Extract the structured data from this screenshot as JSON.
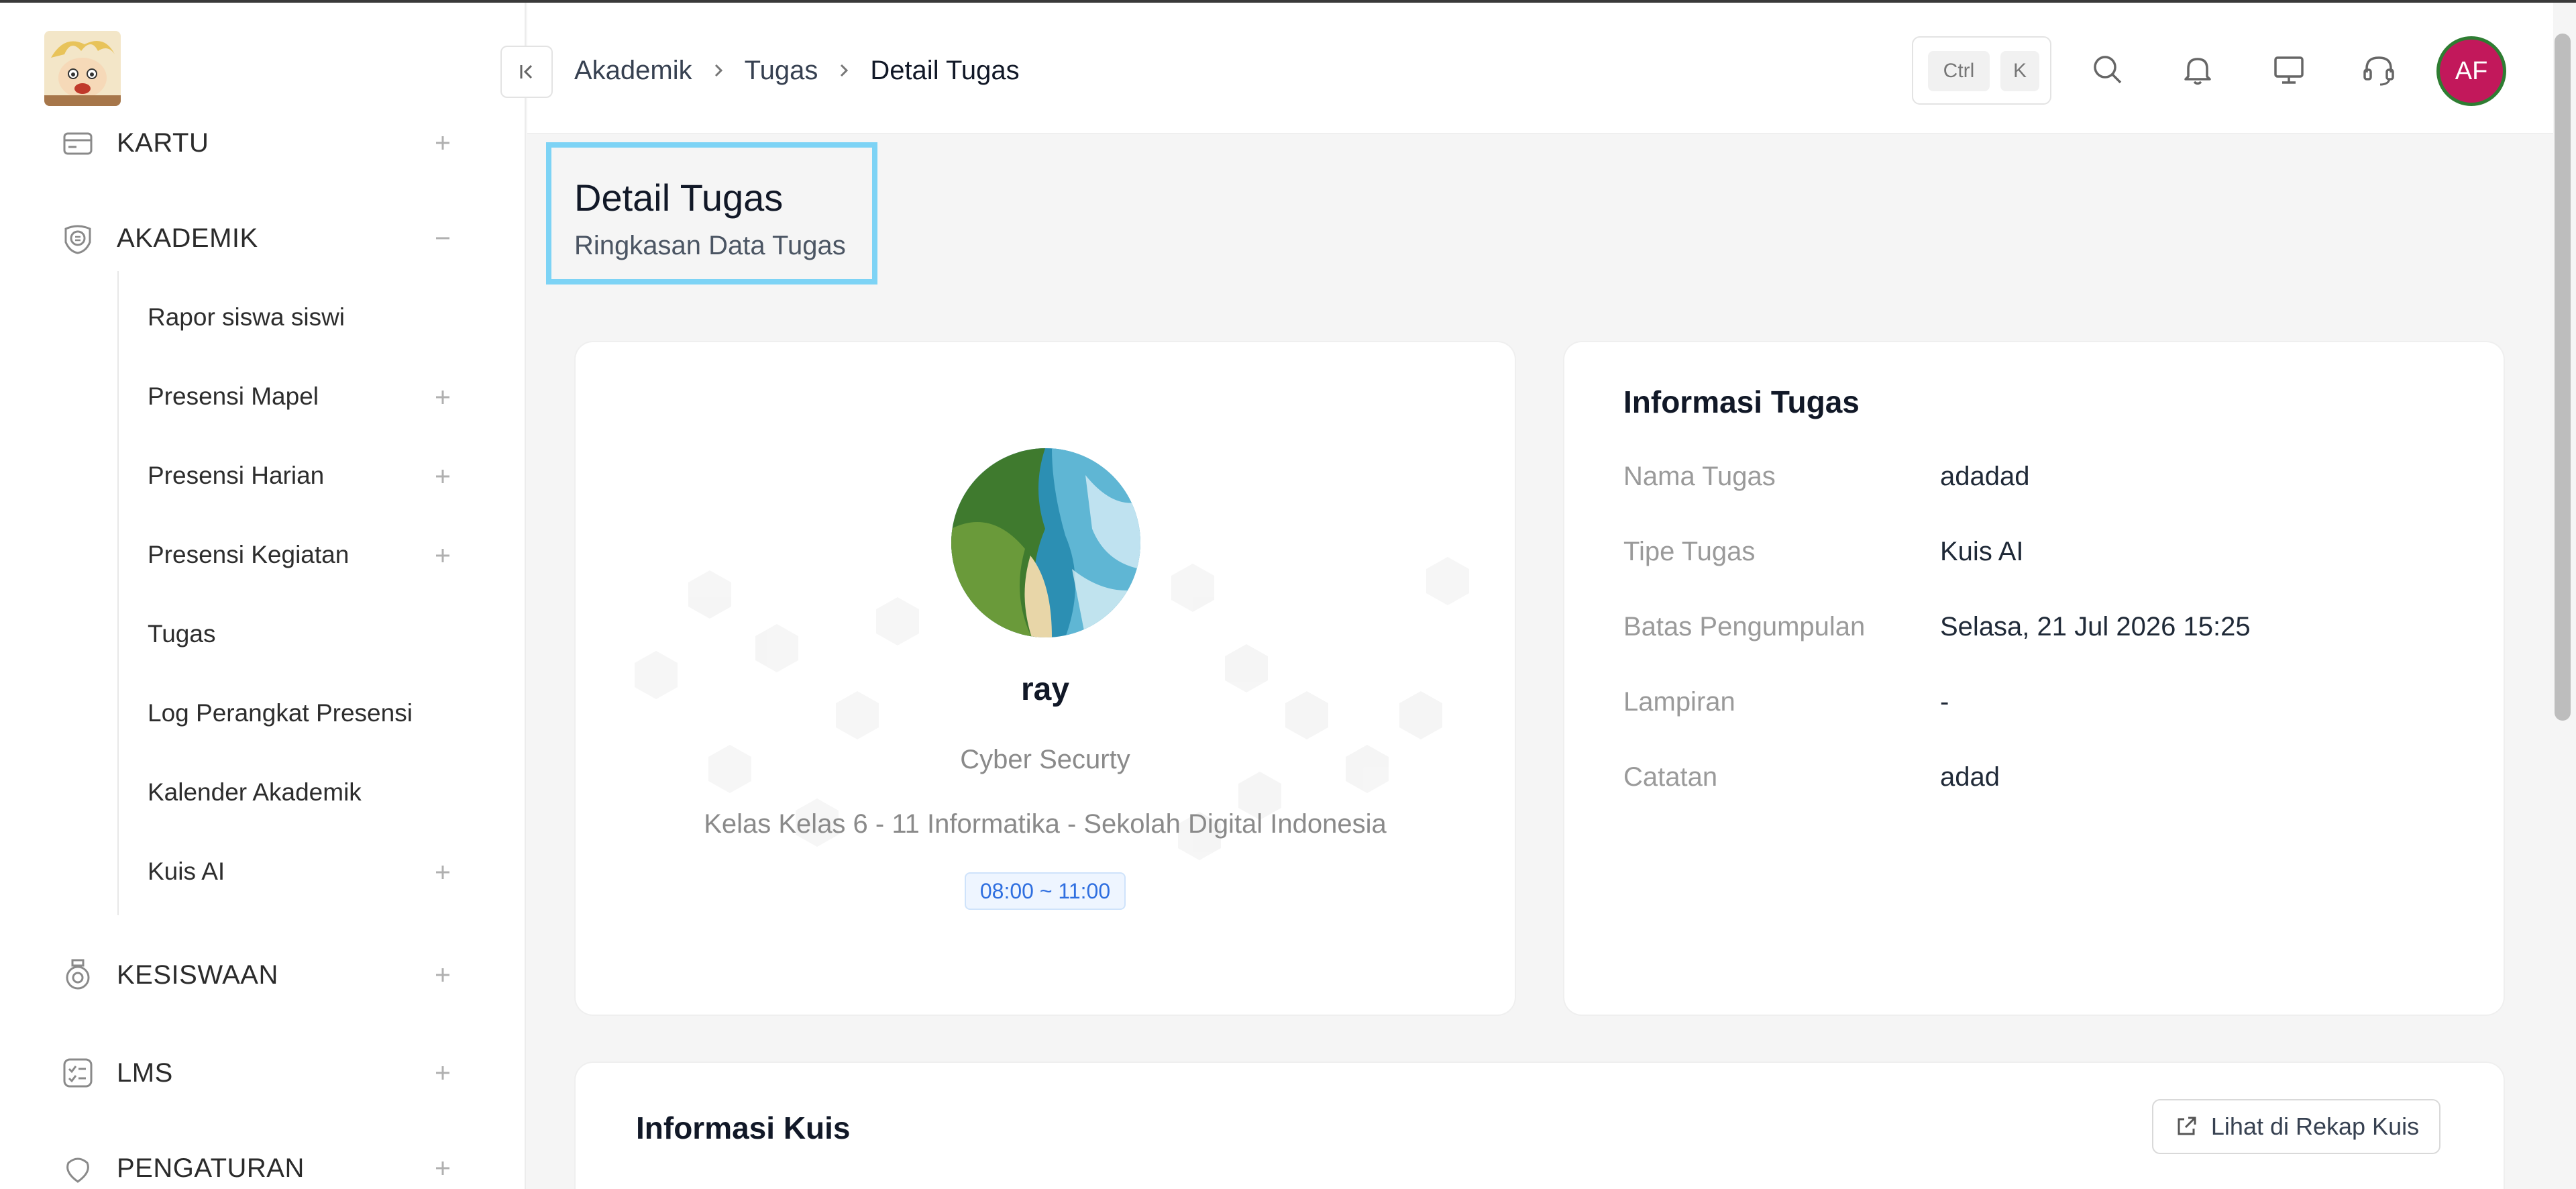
{
  "breadcrumb": [
    "Akademik",
    "Tugas",
    "Detail Tugas"
  ],
  "header": {
    "kbd_ctrl": "Ctrl",
    "kbd_k": "K",
    "user_initials": "AF"
  },
  "sidebar": {
    "groups": [
      {
        "label": "KARTU",
        "state": "collapsed",
        "icon": "card-icon"
      },
      {
        "label": "AKADEMIK",
        "state": "expanded",
        "icon": "academic-icon"
      },
      {
        "label": "KESISWAAN",
        "state": "collapsed",
        "icon": "student-badge-icon"
      },
      {
        "label": "LMS",
        "state": "collapsed",
        "icon": "checklist-icon"
      },
      {
        "label": "PENGATURAN",
        "state": "collapsed",
        "icon": "settings-icon"
      }
    ],
    "academic_items": [
      {
        "label": "Rapor siswa siswi",
        "expandable": false
      },
      {
        "label": "Presensi Mapel",
        "expandable": true
      },
      {
        "label": "Presensi Harian",
        "expandable": true
      },
      {
        "label": "Presensi Kegiatan",
        "expandable": true
      },
      {
        "label": "Tugas",
        "expandable": false
      },
      {
        "label": "Log Perangkat Presensi",
        "expandable": false
      },
      {
        "label": "Kalender Akademik",
        "expandable": false
      },
      {
        "label": "Kuis AI",
        "expandable": true
      }
    ]
  },
  "page": {
    "title": "Detail Tugas",
    "subtitle": "Ringkasan Data Tugas"
  },
  "profile": {
    "name": "ray",
    "subject": "Cyber Securty",
    "class": "Kelas Kelas 6 - 11 Informatika - Sekolah Digital Indonesia",
    "time": "08:00 ~ 11:00"
  },
  "info": {
    "title": "Informasi Tugas",
    "rows": [
      {
        "label": "Nama Tugas",
        "value": "adadad"
      },
      {
        "label": "Tipe Tugas",
        "value": "Kuis AI"
      },
      {
        "label": "Batas Pengumpulan",
        "value": "Selasa, 21 Jul 2026 15:25"
      },
      {
        "label": "Lampiran",
        "value": "-"
      },
      {
        "label": "Catatan",
        "value": "adad"
      }
    ]
  },
  "kuis": {
    "title": "Informasi Kuis",
    "button": "Lihat di Rekap Kuis"
  },
  "colors": {
    "accent": "#7dd3f5",
    "avatar_bg": "#c2185b",
    "avatar_ring": "#2e7d32",
    "time_badge": "#2f6fe0"
  }
}
